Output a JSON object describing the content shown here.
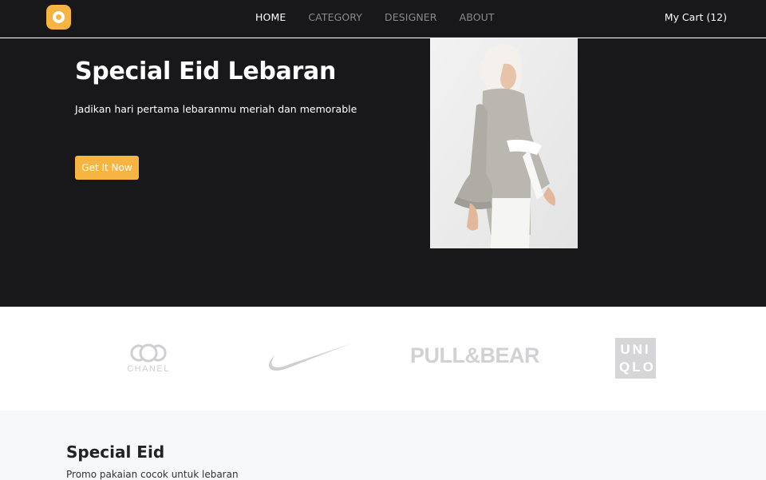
{
  "nav": {
    "links": [
      "HOME",
      "CATEGORY",
      "DESIGNER",
      "ABOUT"
    ],
    "cart": "My Cart (12)"
  },
  "hero": {
    "title": "Special Eid Lebaran",
    "subtitle": "Jadikan hari pertama lebaranmu meriah dan memorable",
    "button": "Get It Now"
  },
  "brands": {
    "chanel": "CHANEL",
    "pullbear": "PULL&BEAR",
    "uniqlo": [
      "UNI",
      "QLO"
    ]
  },
  "section": {
    "title": "Special Eid",
    "subtitle": "Promo pakaian cocok untuk lebaran"
  },
  "colors": {
    "accent": "#f7b442",
    "dark": "#18181a",
    "logo_gray": "#cfcfd1"
  }
}
